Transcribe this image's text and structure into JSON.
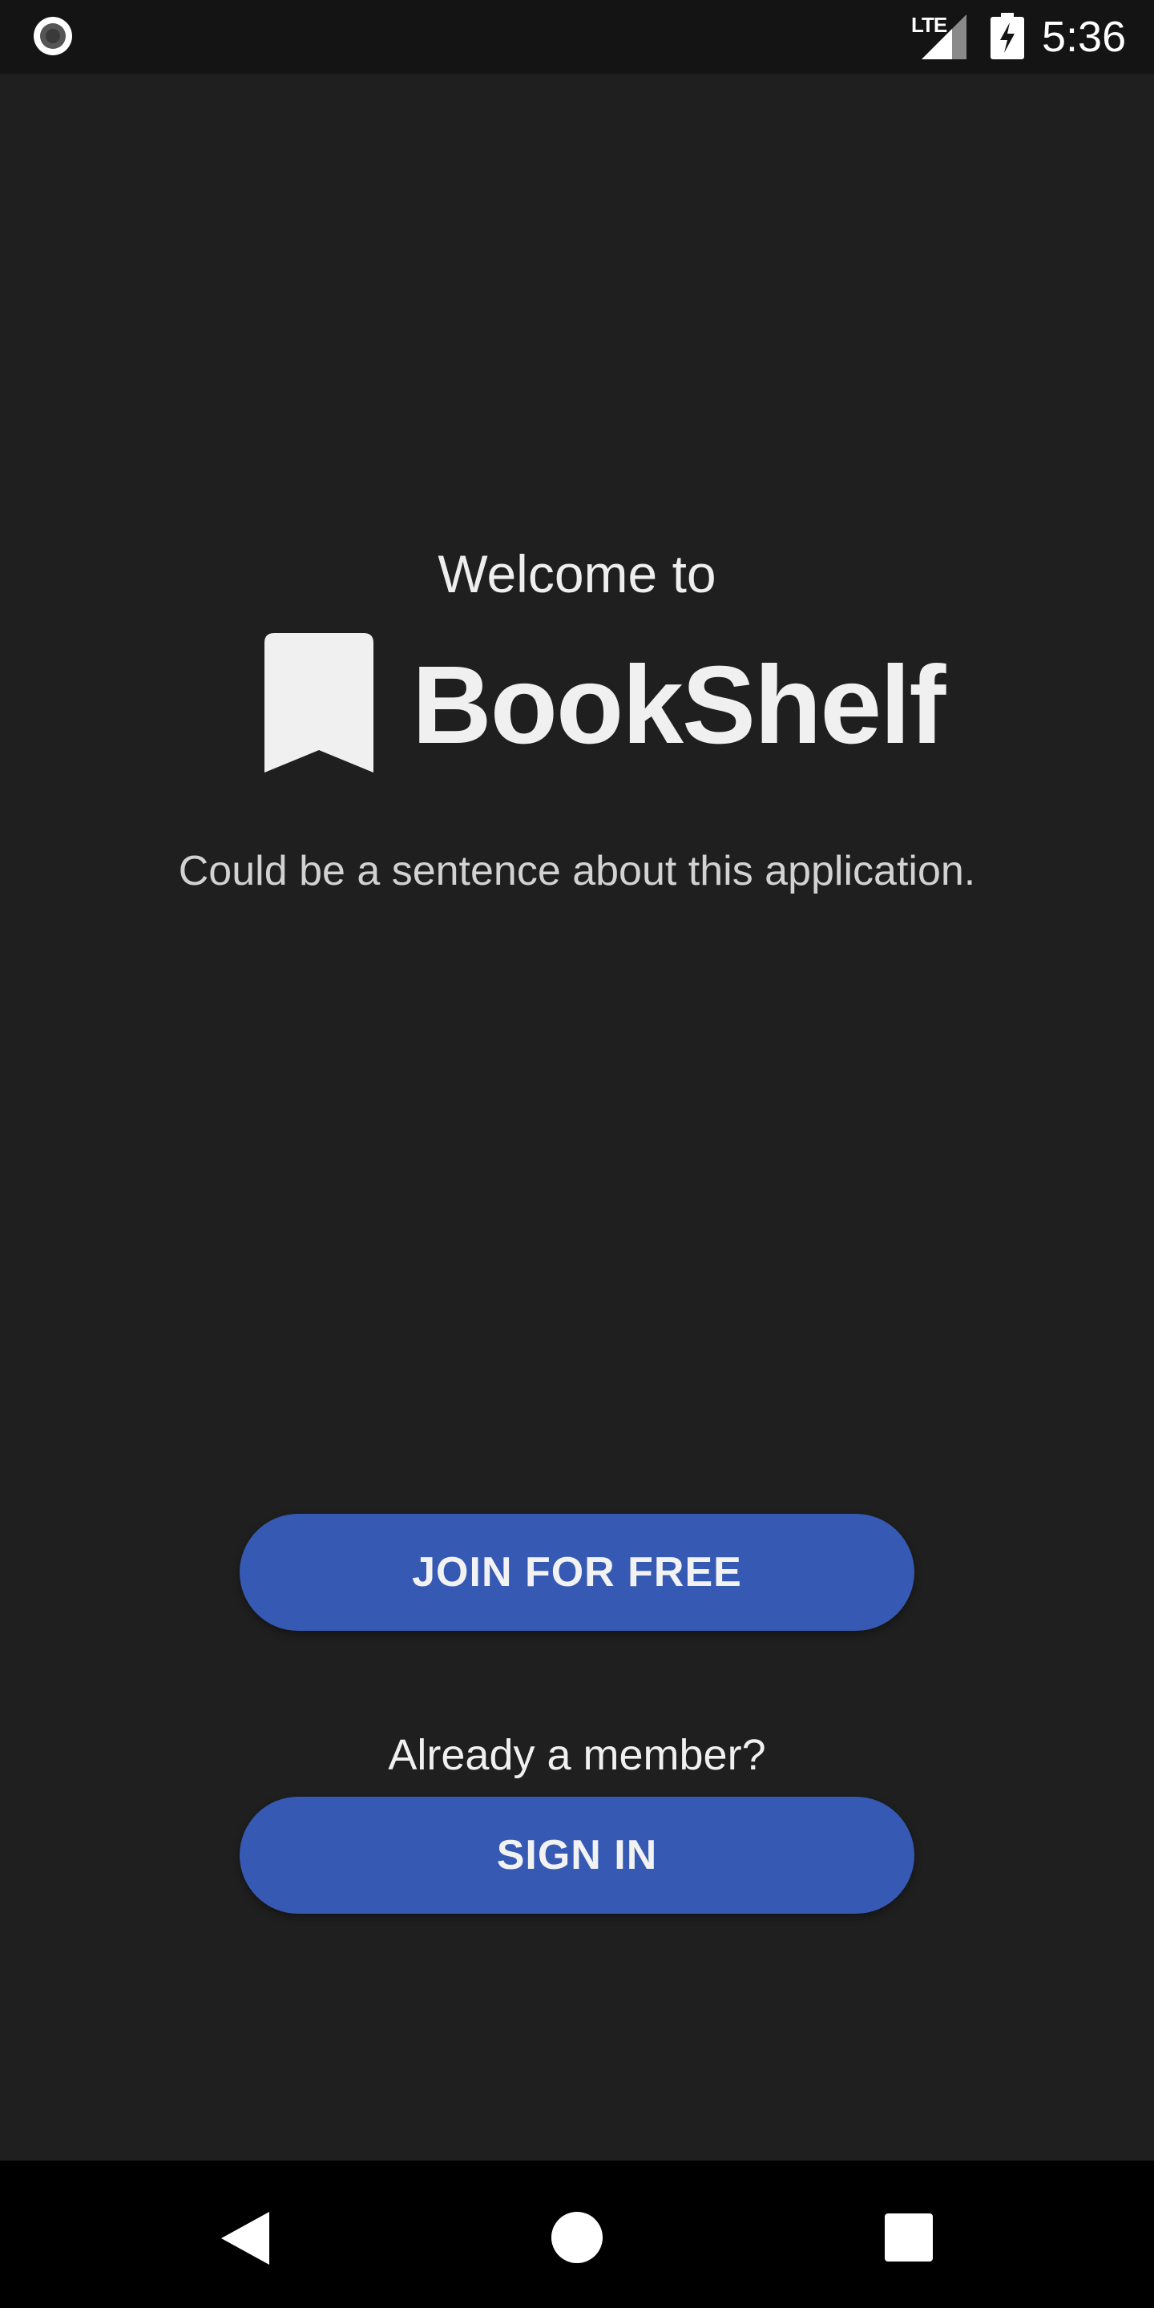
{
  "status_bar": {
    "network_label": "LTE",
    "time": "5:36",
    "icons": [
      "record-indicator-icon",
      "signal-icon",
      "battery-charging-icon"
    ]
  },
  "welcome": {
    "intro": "Welcome to",
    "app_name": "BookShelf",
    "logo_icon": "bookmark-icon",
    "tagline": "Could be a sentence about this application."
  },
  "actions": {
    "join_label": "JOIN FOR FREE",
    "member_prompt": "Already a member?",
    "sign_in_label": "SIGN IN"
  },
  "nav_bar": {
    "icons": [
      "back-icon",
      "home-icon",
      "recents-icon"
    ]
  },
  "colors": {
    "background": "#1f1f1f",
    "status_bar": "#141414",
    "button": "#3659b3",
    "nav_bar": "#000000"
  }
}
